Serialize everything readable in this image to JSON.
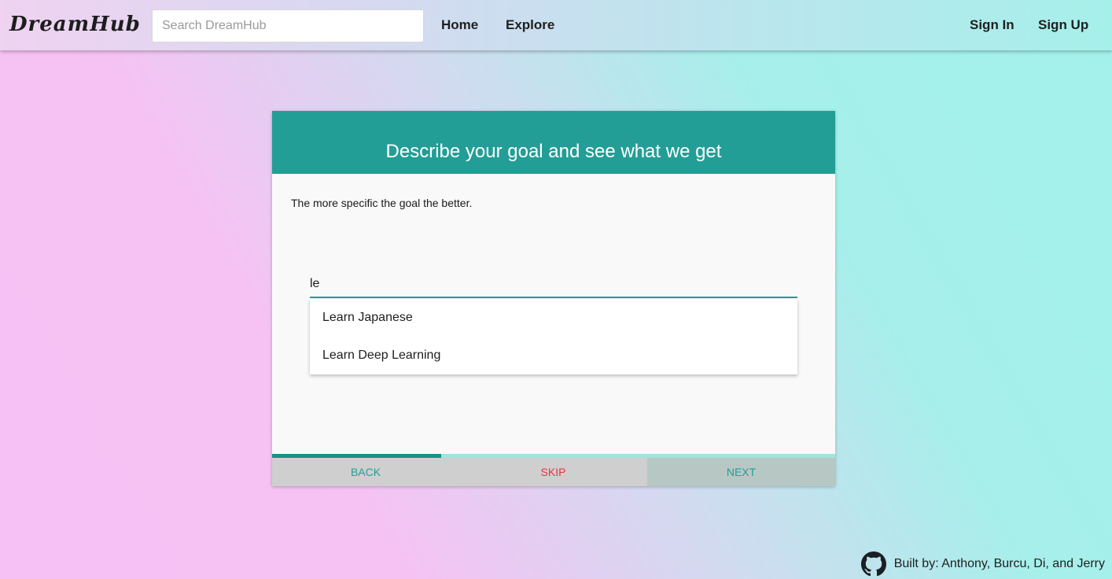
{
  "navbar": {
    "brand": "DreamHub",
    "search_placeholder": "Search DreamHub",
    "links": [
      {
        "label": "Home"
      },
      {
        "label": "Explore"
      },
      {
        "label": "Sign In"
      },
      {
        "label": "Sign Up"
      }
    ]
  },
  "card": {
    "title": "Describe your goal and see what we get",
    "hint": "The more specific the goal the better.",
    "goal_input_value": "le",
    "suggestions": [
      {
        "label": "Learn Japanese"
      },
      {
        "label": "Learn Deep Learning"
      }
    ],
    "progress": 0.3,
    "actions": {
      "back": "BACK",
      "skip": "SKIP",
      "next": "NEXT"
    }
  },
  "footer": {
    "icon": "github-icon",
    "text": "Built by: Anthony, Burcu, Di, and Jerry"
  },
  "colors": {
    "accent": "#239e96",
    "skip": "#f2303c",
    "action_bar": "#cfcfcf",
    "next_bg": "#b7c8c4"
  }
}
